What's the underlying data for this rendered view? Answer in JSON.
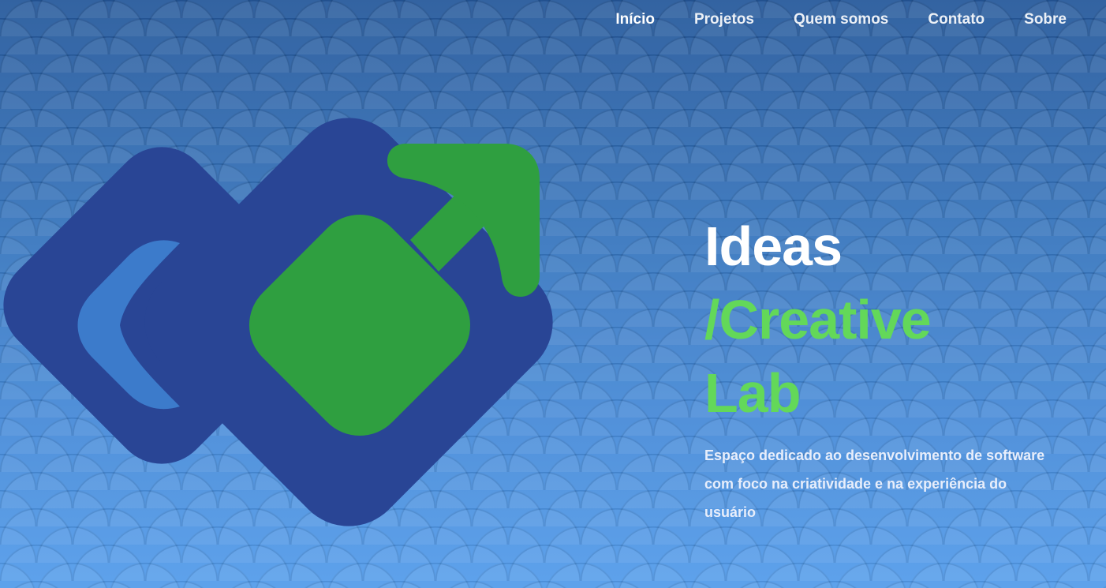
{
  "nav": {
    "items": [
      {
        "label": "Início",
        "active": true
      },
      {
        "label": "Projetos",
        "active": false
      },
      {
        "label": "Quem somos",
        "active": false
      },
      {
        "label": "Contato",
        "active": false
      },
      {
        "label": "Sobre",
        "active": false
      }
    ]
  },
  "hero": {
    "title_line1": "Ideas",
    "title_line2": "/Creative",
    "title_line3": "Lab",
    "subtitle": "Espaço dedicado ao desenvolvimento de software com foco na criatividade e na experiência do usuário"
  },
  "logo": {
    "icon": "ideas-creative-lab-logo-icon"
  },
  "colors": {
    "background_top": "#24579a",
    "background_bottom": "#529bea",
    "logo_navy": "#294595",
    "logo_green": "#2f9f40",
    "accent_green_text": "#63d859",
    "text_white": "#ffffff"
  }
}
